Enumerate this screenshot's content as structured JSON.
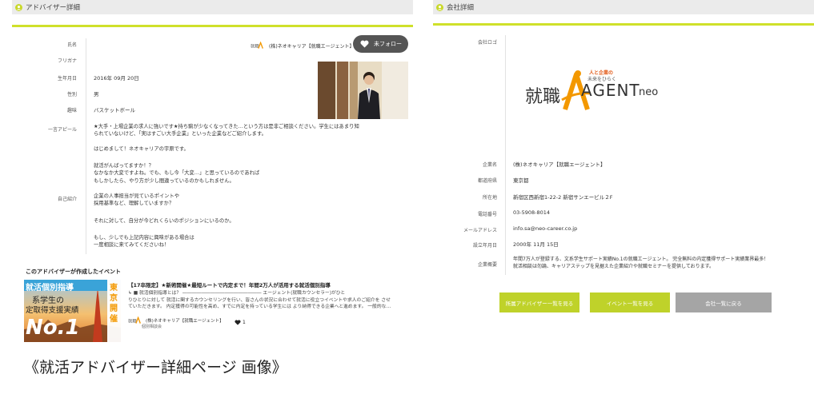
{
  "advisor_panel": {
    "title": "アドバイザー詳細",
    "company": "(株)ネオキャリア【就職エージェント】",
    "follow_label": "未フォロー",
    "fields": {
      "name_label": "氏名",
      "name_value": "",
      "kana_label": "フリガナ",
      "kana_value": "",
      "birth_label": "生年月日",
      "birth_value": "2016年 09月 20日",
      "sex_label": "性別",
      "sex_value": "男",
      "hobby_label": "趣味",
      "hobby_value": "バスケットボール",
      "appeal_label": "一言アピール",
      "appeal_lines": [
        "★大手・上場企業の求人に強いです★持ち駒が少なくなってきた…という方は是非ご相談ください。学生にはあまり知",
        "られていないけど、「実はすごい大手企業」といった企業などご紹介します。"
      ],
      "intro_line": "はじめまして！ネオキャリアの宇原です。",
      "q_lines": [
        "就活がんばってますか！？",
        "なかなか大変ですよね。でも、もし今「大変…」と思っているのであれば",
        "もしかしたら、やり方が少し間違っているのかもしれません。"
      ],
      "self_label": "自己紹介",
      "self_lines": [
        "企業の人事担当が見ているポイントや",
        "採用基準など、理解していますか？"
      ],
      "pos_line": "それに対して、自分が今どれくらいのポジションにいるのか。",
      "end_lines": [
        "もし、少しでも上記内容に興味がある場合は",
        "一度相談に来てみてくださいね！"
      ]
    },
    "events_heading": "このアドバイザーが作成したイベント",
    "event": {
      "thumb_line1": "就活個別指導",
      "thumb_line2": "系学生の",
      "thumb_line3": "定取得支援実績",
      "thumb_big": "No.1",
      "thumb_side": "東 京 開 催",
      "title": "【17卒限定】★新術開催★最短ルートで内定まで！年間2万人が活用する就活個別指導",
      "body_lines": [
        "■ 就活個別指導とは？ ――――――――――――――――― エージェント(就職カウンセラー)がひと",
        "りひとりに対して 就活に関するカウンセリングを行い、皆さんの状況に合わせて就活に役立つイベントや求人のご紹介を させ",
        "ていただきます。 内定獲得の可能性を高め、すでに内定を持っている学生には より納得できる企業へと進めます。 一般的な…"
      ],
      "company": "(株)ネオキャリア【就職エージェント】",
      "sub": "個別相談会",
      "likes": "1"
    }
  },
  "company_panel": {
    "title": "会社詳細",
    "logo_label": "会社ロゴ",
    "logo": {
      "main": "就職",
      "agent": "AGENT",
      "neo": "neo",
      "tagline1": "人と企業の",
      "tagline2": "未来をひらく"
    },
    "rows": [
      {
        "label": "企業名",
        "value": "(株)ネオキャリア【就職エージェント】"
      },
      {
        "label": "都道府県",
        "value": "東京都"
      },
      {
        "label": "所在地",
        "value": "新宿区西新宿1-22-2 新宿サンエービル２F"
      },
      {
        "label": "電話番号",
        "value": "03-5908-8014"
      },
      {
        "label": "メールアドレス",
        "value": "info.sa@neo-career.co.jp"
      },
      {
        "label": "設立年月日",
        "value": "2000年 11月 15日"
      }
    ],
    "summary_label": "企業概要",
    "summary_lines": [
      "年間7万人が登録する、文系学生サポート実績No.1の就職エージェント。 完全無料の内定獲得サポート実績業界最多！",
      "就活相談は勿論、キャリアステップを見据えた企業紹介や就職セミナーを提供しております。"
    ],
    "buttons": {
      "advisors": "所属アドバイザー一覧を見る",
      "events": "イベント一覧を見る",
      "companies": "会社一覧に戻る"
    }
  },
  "caption": "《就活アドバイザー詳細ページ 画像》",
  "colors": {
    "accent": "#cfe02a",
    "button_green": "#bfd22a",
    "orange": "#f39800"
  }
}
